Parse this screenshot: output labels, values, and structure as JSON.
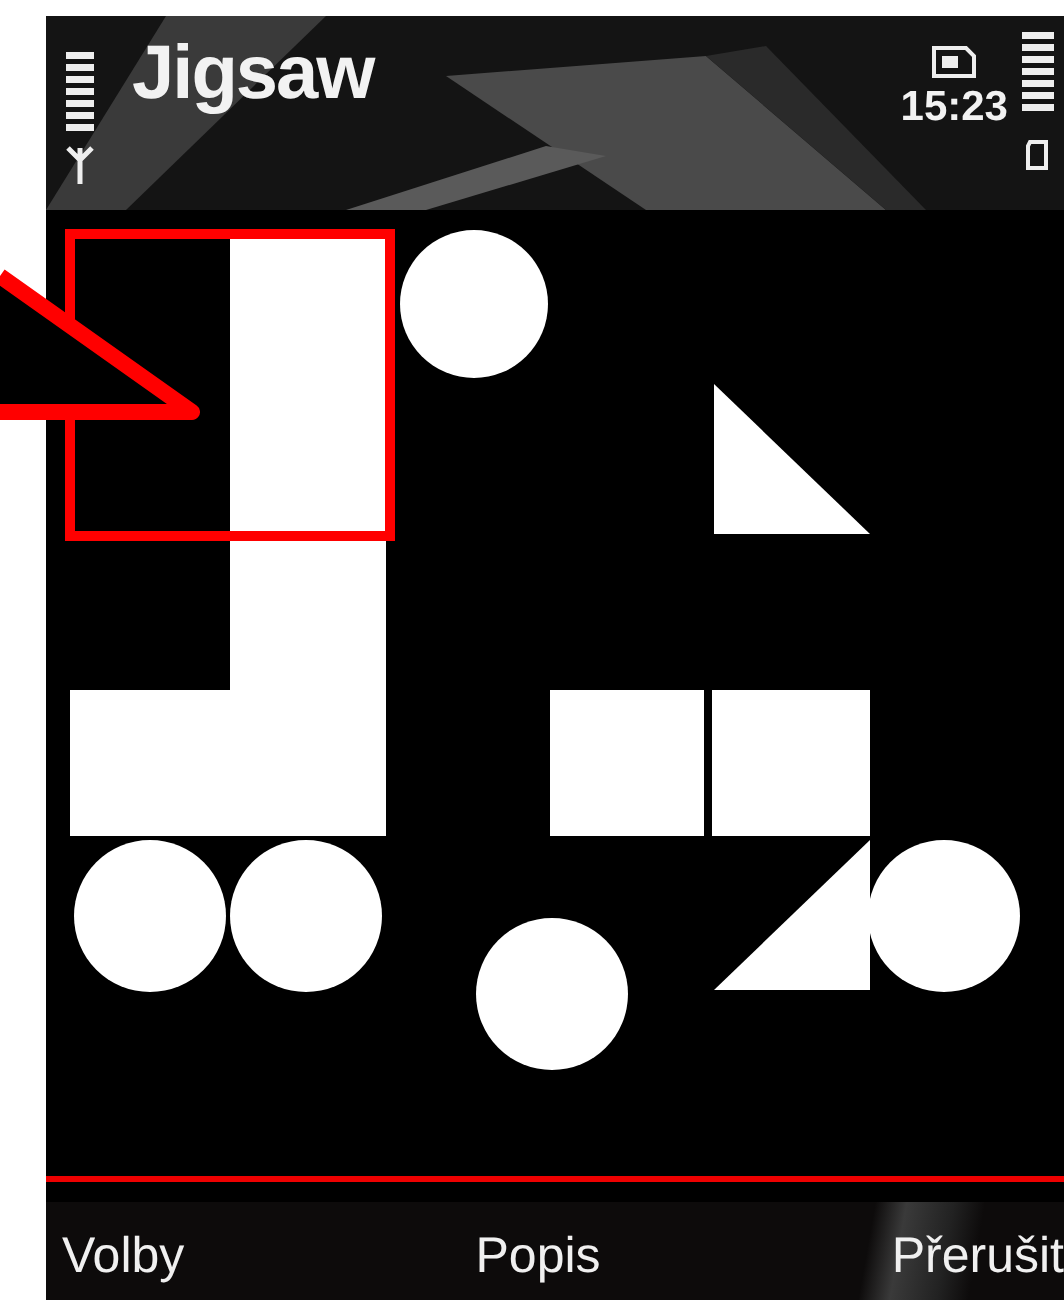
{
  "status_bar": {
    "title": "Jigsaw",
    "time": "15:23"
  },
  "softkeys": [
    "Volby",
    "Popis",
    "Přerušit"
  ]
}
